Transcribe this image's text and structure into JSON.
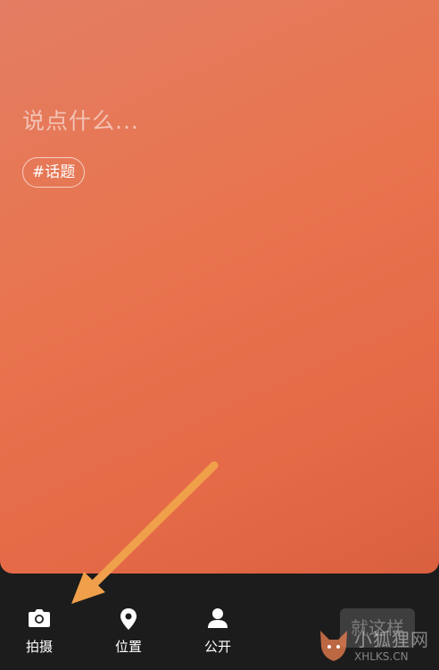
{
  "composer": {
    "placeholder": "说点什么...",
    "topic_tag": "#话题"
  },
  "toolbar": {
    "items": [
      {
        "label": "拍摄",
        "icon": "camera-icon"
      },
      {
        "label": "位置",
        "icon": "location-pin-icon"
      },
      {
        "label": "公开",
        "icon": "person-icon"
      }
    ],
    "done_label": "就这样"
  },
  "watermark": {
    "text_cn": "小狐狸网",
    "text_en": "XHLKS.CN"
  },
  "colors": {
    "card_gradient_start": "#e37d63",
    "card_gradient_end": "#d9603f",
    "toolbar_bg": "#1c1c1c",
    "arrow": "#f0a04a"
  }
}
